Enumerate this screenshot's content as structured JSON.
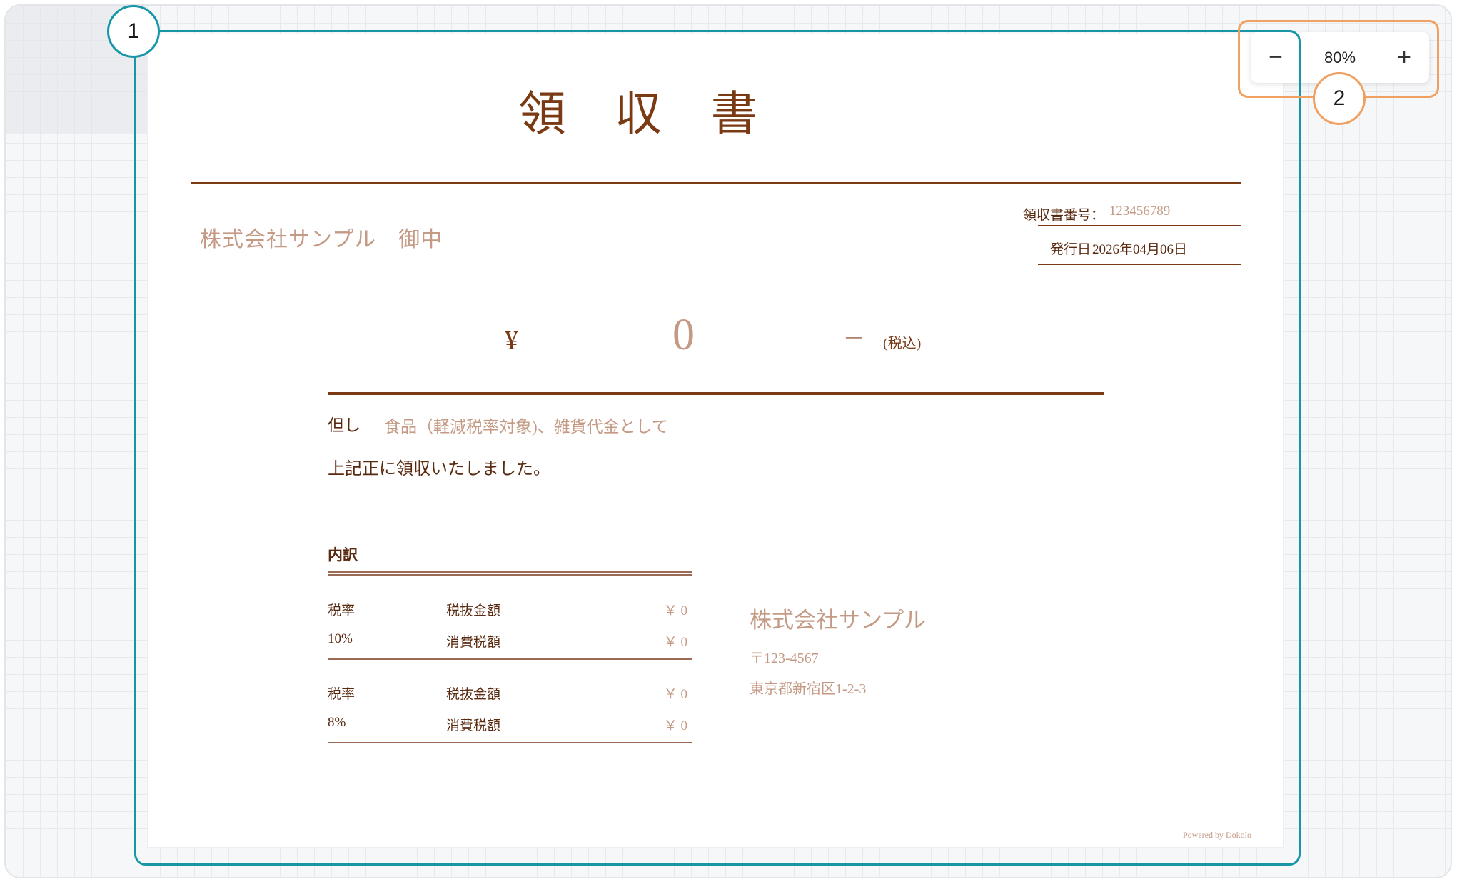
{
  "receipt": {
    "title": "領 収 書",
    "recipient": "株式会社サンプル　御中",
    "number_label": "領収書番号：",
    "number_value": "123456789",
    "issue_date_label": "発行日：",
    "issue_date_value": "2026年04月06日",
    "currency_symbol": "¥",
    "amount": "0",
    "dash": "—",
    "tax_included": "(税込)",
    "tadashi_label": "但し",
    "tadashi_text": "食品（軽減税率対象)、雑貨代金として",
    "confirmation": "上記正に領収いたしました。",
    "breakdown": {
      "title": "内訳",
      "groups": [
        {
          "rate_label": "税率",
          "rate_value": "10%",
          "net_label": "税抜金額",
          "net_value": "￥ 0",
          "tax_label": "消費税額",
          "tax_value": "￥ 0"
        },
        {
          "rate_label": "税率",
          "rate_value": "8%",
          "net_label": "税抜金額",
          "net_value": "￥ 0",
          "tax_label": "消費税額",
          "tax_value": "￥ 0"
        }
      ]
    },
    "company": {
      "name": "株式会社サンプル",
      "postal": "〒123-4567",
      "address": "東京都新宿区1-2-3"
    },
    "powered_by": "Powered by Dokolo"
  },
  "zoom": {
    "minus_icon": "−",
    "level": "80%",
    "plus_icon": "+"
  },
  "annotations": {
    "marker_1": "1",
    "marker_2": "2",
    "color_1": "#1796a8",
    "color_2": "#f0a060"
  },
  "colors": {
    "accent_brown": "#7a3a14",
    "muted_brown": "#c49a85"
  }
}
